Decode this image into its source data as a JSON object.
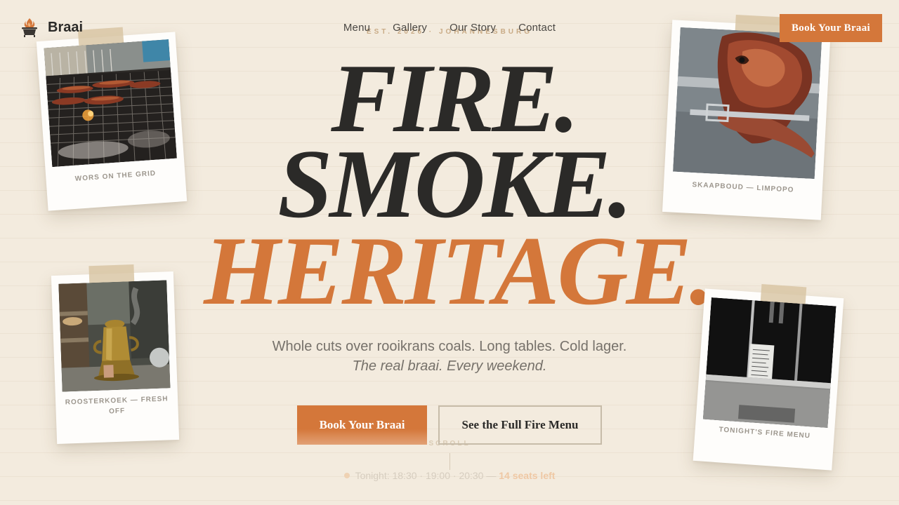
{
  "brand": {
    "name": "Braai",
    "icon": "braai-pot-icon"
  },
  "nav": {
    "links": [
      "Menu",
      "Gallery",
      "Our Story",
      "Contact"
    ],
    "cta": "Book Your Braai"
  },
  "hero": {
    "est": "EST. 2026 · JOHANNESBURG",
    "headline": [
      "FIRE.",
      "SMOKE.",
      "HERITAGE."
    ],
    "subline": "Whole cuts over rooikrans coals. Long tables. Cold lager.",
    "tagline": "The real braai. Every weekend.",
    "primary_cta": "Book Your Braai",
    "secondary_cta": "See the Full Fire Menu",
    "scroll_label": "SCROLL"
  },
  "status": {
    "prefix": "Tonight: 18:30 · 19:00 · 20:30 —",
    "seats": "14 seats left"
  },
  "photos": [
    {
      "caption": "WORS ON THE GRID",
      "icon": "grill-photo"
    },
    {
      "caption": "SKAAPBOUD — LIMPOPO",
      "icon": "spit-roast-photo"
    },
    {
      "caption": "ROOSTERKOEK — FRESH OFF",
      "icon": "kettle-photo"
    },
    {
      "caption": "TONIGHT'S FIRE MENU",
      "icon": "menu-board-photo"
    }
  ],
  "colors": {
    "accent": "#d4773a",
    "background": "#f3ebde",
    "ink": "#2b2a28"
  }
}
